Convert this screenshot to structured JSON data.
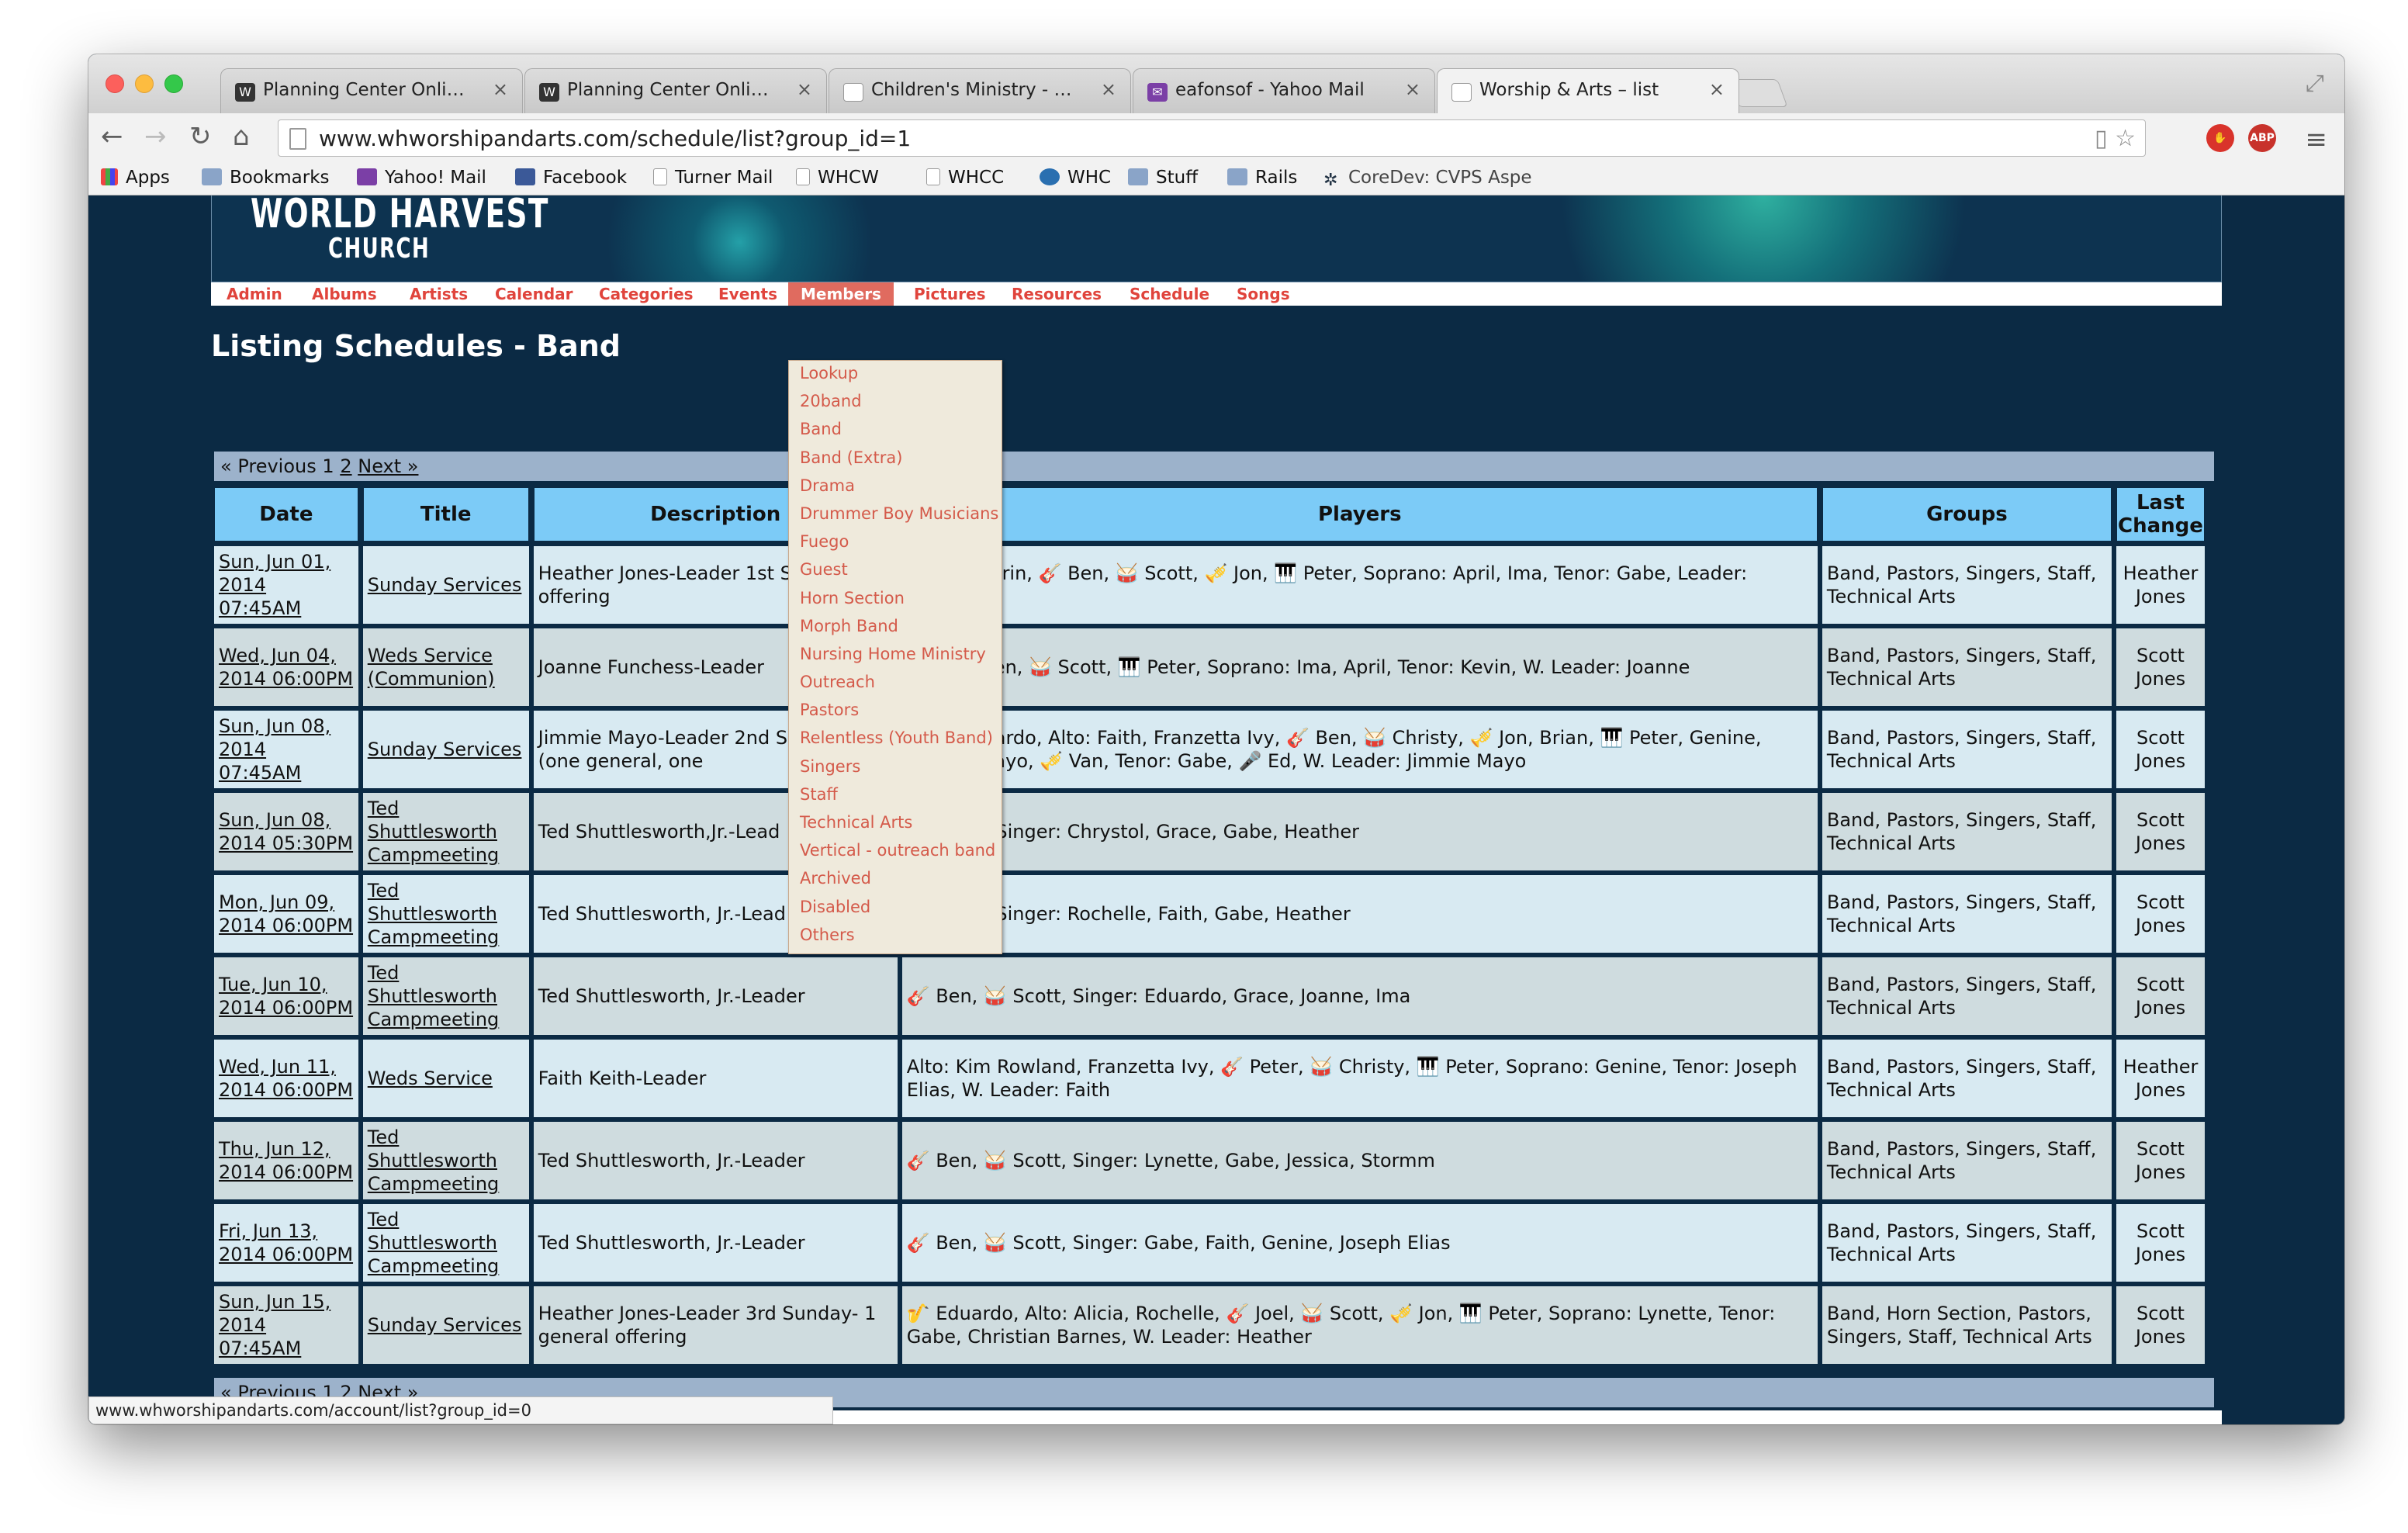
{
  "browser": {
    "tabs": [
      {
        "title": "Planning Center Online – Jo",
        "favicon": "planning-center-icon"
      },
      {
        "title": "Planning Center Online – Jo",
        "favicon": "planning-center-icon"
      },
      {
        "title": "Children's Ministry - show",
        "favicon": "page-icon"
      },
      {
        "title": "eafonsof - Yahoo Mail",
        "favicon": "yahoo-mail-icon"
      },
      {
        "title": "Worship & Arts – list",
        "favicon": "page-icon"
      }
    ],
    "url": "www.whworshipandarts.com/schedule/list?group_id=1",
    "bookmarks": [
      "Apps",
      "Bookmarks",
      "Yahoo! Mail",
      "Facebook",
      "Turner Mail",
      "WHCW",
      "WHCC",
      "WHC",
      "Stuff",
      "Rails",
      "CoreDev: CVPS Aspe"
    ],
    "status_url": "www.whworshipandarts.com/account/list?group_id=0",
    "abp_label": "ABP"
  },
  "site": {
    "logo_line1": "WORLD HARVEST",
    "logo_line2": "CHURCH",
    "nav": [
      "Admin",
      "Albums",
      "Artists",
      "Calendar",
      "Categories",
      "Events",
      "Members",
      "Pictures",
      "Resources",
      "Schedule",
      "Songs"
    ],
    "active_nav": "Members",
    "members_menu": [
      "Lookup",
      "20band",
      "Band",
      "Band (Extra)",
      "Drama",
      "Drummer Boy Musicians",
      "Fuego",
      "Guest",
      "Horn Section",
      "Morph Band",
      "Nursing Home Ministry",
      "Outreach",
      "Pastors",
      "Relentless (Youth Band)",
      "Singers",
      "Staff",
      "Technical Arts",
      "Vertical - outreach band",
      "Archived",
      "Disabled",
      "Others"
    ]
  },
  "page": {
    "heading": "Listing Schedules - Band",
    "pager": {
      "prev": "« Previous",
      "page1": "1",
      "page2": "2",
      "next": "Next »"
    },
    "columns": [
      "Date",
      "Title",
      "Description",
      "Players",
      "Groups",
      "Last Change"
    ],
    "rows": [
      {
        "date": "Sun, Jun 01, 2014 07:45AM",
        "title": "Sunday Services",
        "desc": "Heather Jones-Leader 1st S general offering",
        "players": "o, Alto: Karin, 🎸 Ben, 🥁 Scott, 🎺 Jon, 🎹 Peter, Soprano: April, Ima, Tenor: Gabe, Leader: Heather",
        "groups": "Band, Pastors, Singers, Staff, Technical Arts",
        "last": "Heather Jones"
      },
      {
        "date": "Wed, Jun 04, 2014 06:00PM",
        "title": "Weds Service (Communion)",
        "desc": "Joanne Funchess-Leader",
        "players": "elle, 🎸 Ben, 🥁 Scott, 🎹 Peter, Soprano: Ima, April, Tenor: Kevin, W. Leader: Joanne",
        "groups": "Band, Pastors, Singers, Staff, Technical Arts",
        "last": "Scott Jones"
      },
      {
        "date": "Sun, Jun 08, 2014 07:45AM",
        "title": "Sunday Services",
        "desc": "Jimmie Mayo-Leader 2nd S offerings (one general, one",
        "players": "o, 🎷 Eduardo, Alto: Faith, Franzetta Ivy, 🎸 Ben, 🥁 Christy, 🎺 Jon, Brian, 🎹 Peter, Genine, Sharon Mayo, 🎺 Van, Tenor: Gabe, 🎤 Ed, W. Leader: Jimmie Mayo",
        "groups": "Band, Pastors, Singers, Staff, Technical Arts",
        "last": "Scott Jones"
      },
      {
        "date": "Sun, Jun 08, 2014 05:30PM",
        "title": "Ted Shuttlesworth Campmeeting",
        "desc": "Ted Shuttlesworth,Jr.-Lead",
        "players": "🥁 Scott, Singer: Chrystol, Grace, Gabe, Heather",
        "groups": "Band, Pastors, Singers, Staff, Technical Arts",
        "last": "Scott Jones"
      },
      {
        "date": "Mon, Jun 09, 2014 06:00PM",
        "title": "Ted Shuttlesworth Campmeeting",
        "desc": "Ted Shuttlesworth, Jr.-Lead",
        "players": "🥁 Scott, Singer: Rochelle, Faith, Gabe, Heather",
        "groups": "Band, Pastors, Singers, Staff, Technical Arts",
        "last": "Scott Jones"
      },
      {
        "date": "Tue, Jun 10, 2014 06:00PM",
        "title": "Ted Shuttlesworth Campmeeting",
        "desc": "Ted Shuttlesworth, Jr.-Leader",
        "players": "🎸 Ben, 🥁 Scott, Singer: Eduardo, Grace, Joanne, Ima",
        "groups": "Band, Pastors, Singers, Staff, Technical Arts",
        "last": "Scott Jones"
      },
      {
        "date": "Wed, Jun 11, 2014 06:00PM",
        "title": "Weds Service",
        "desc": "Faith Keith-Leader",
        "players": "Alto: Kim Rowland, Franzetta Ivy, 🎸 Peter, 🥁 Christy, 🎹 Peter, Soprano: Genine, Tenor: Joseph Elias, W. Leader: Faith",
        "groups": "Band, Pastors, Singers, Staff, Technical Arts",
        "last": "Heather Jones"
      },
      {
        "date": "Thu, Jun 12, 2014 06:00PM",
        "title": "Ted Shuttlesworth Campmeeting",
        "desc": "Ted Shuttlesworth, Jr.-Leader",
        "players": "🎸 Ben, 🥁 Scott, Singer: Lynette, Gabe, Jessica, Stormm",
        "groups": "Band, Pastors, Singers, Staff, Technical Arts",
        "last": "Scott Jones"
      },
      {
        "date": "Fri, Jun 13, 2014 06:00PM",
        "title": "Ted Shuttlesworth Campmeeting",
        "desc": "Ted Shuttlesworth, Jr.-Leader",
        "players": "🎸 Ben, 🥁 Scott, Singer: Gabe, Faith, Genine, Joseph Elias",
        "groups": "Band, Pastors, Singers, Staff, Technical Arts",
        "last": "Scott Jones"
      },
      {
        "date": "Sun, Jun 15, 2014 07:45AM",
        "title": "Sunday Services",
        "desc": "Heather Jones-Leader 3rd Sunday- 1 general offering",
        "players": "🎷 Eduardo, Alto: Alicia, Rochelle, 🎸 Joel, 🥁 Scott, 🎺 Jon, 🎹 Peter, Soprano: Lynette, Tenor: Gabe, Christian Barnes, W. Leader: Heather",
        "groups": "Band, Horn Section, Pastors, Singers, Staff, Technical Arts",
        "last": "Scott Jones"
      }
    ]
  }
}
